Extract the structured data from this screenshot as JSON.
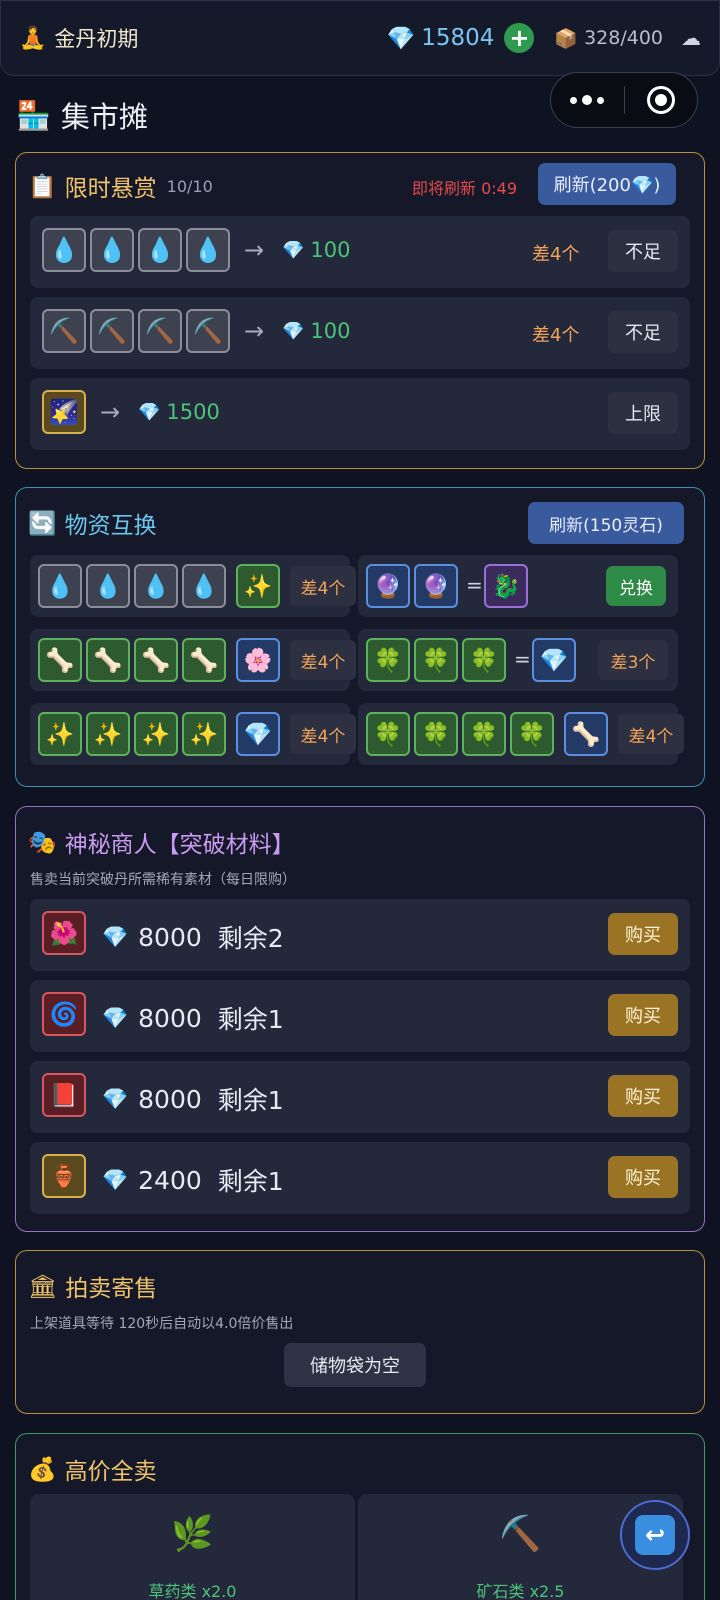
{
  "topbar": {
    "realm_icon": "🧘",
    "realm": "金丹初期",
    "gem_icon": "💎",
    "gems": "15804",
    "plus": "+",
    "bag_icon": "📦",
    "bag": "328/400",
    "cloud_icon": "☁"
  },
  "page": {
    "icon": "🏪",
    "title": "集市摊"
  },
  "bounty": {
    "icon": "📋",
    "title": "限时悬赏",
    "count": "10/10",
    "refresh_note": "即将刷新 0:49",
    "refresh_button": "刷新(200💎)",
    "rows": [
      {
        "items": [
          "💧",
          "💧",
          "💧",
          "💧"
        ],
        "arrow": "→",
        "gem": "💎",
        "reward": "100",
        "lack": "差4个",
        "button": "不足"
      },
      {
        "items": [
          "⛏️",
          "⛏️",
          "⛏️",
          "⛏️"
        ],
        "arrow": "→",
        "gem": "💎",
        "reward": "100",
        "lack": "差4个",
        "button": "不足"
      },
      {
        "items": [
          "🌠"
        ],
        "arrow": "→",
        "gem": "💎",
        "reward": "1500",
        "lack": "",
        "button": "上限"
      }
    ]
  },
  "exchange": {
    "icon": "🔄",
    "title": "物资互换",
    "refresh_button": "刷新(150灵石)",
    "cards": [
      {
        "items": [
          "💧",
          "💧",
          "💧",
          "💧"
        ],
        "target": "✨",
        "lack": "差4个"
      },
      {
        "items": [
          "🔮",
          "🔮"
        ],
        "eq": "=",
        "target": "🐉",
        "button": "兑换"
      },
      {
        "items": [
          "🦴",
          "🦴",
          "🦴",
          "🦴"
        ],
        "target": "🌸",
        "lack": "差4个"
      },
      {
        "items": [
          "🍀",
          "🍀",
          "🍀"
        ],
        "eq": "=",
        "target": "💎",
        "lack": "差3个"
      },
      {
        "items": [
          "✨",
          "✨",
          "✨",
          "✨"
        ],
        "target": "💎",
        "lack": "差4个"
      },
      {
        "items": [
          "🍀",
          "🍀",
          "🍀",
          "🍀"
        ],
        "target": "🦴",
        "lack": "差4个"
      }
    ]
  },
  "merchant": {
    "icon": "🎭",
    "title": "神秘商人【突破材料】",
    "desc": "售卖当前突破丹所需稀有素材（每日限购）",
    "rows": [
      {
        "item": "🌺",
        "gem": "💎",
        "price": "8000",
        "remain": "剩余2",
        "button": "购买"
      },
      {
        "item": "🌀",
        "gem": "💎",
        "price": "8000",
        "remain": "剩余1",
        "button": "购买"
      },
      {
        "item": "📕",
        "gem": "💎",
        "price": "8000",
        "remain": "剩余1",
        "button": "购买"
      },
      {
        "item": "🏺",
        "gem": "💎",
        "price": "2400",
        "remain": "剩余1",
        "button": "购买"
      }
    ]
  },
  "auction": {
    "icon": "🏛",
    "title": "拍卖寄售",
    "desc": "上架道具等待 120秒后自动以4.0倍价售出",
    "empty_button": "储物袋为空"
  },
  "sell": {
    "icon": "💰",
    "title": "高价全卖",
    "cards": [
      {
        "icon": "🌿",
        "label": "草药类 x2.0"
      },
      {
        "icon": "⛏️",
        "label": "矿石类 x2.5"
      }
    ]
  },
  "fab": {
    "icon": "↩"
  },
  "colors": {
    "accent_green": "#4cc47a",
    "gem_blue": "#7cc4f0",
    "warning_red": "#e64a4a",
    "lack_orange": "#f2a35a"
  }
}
